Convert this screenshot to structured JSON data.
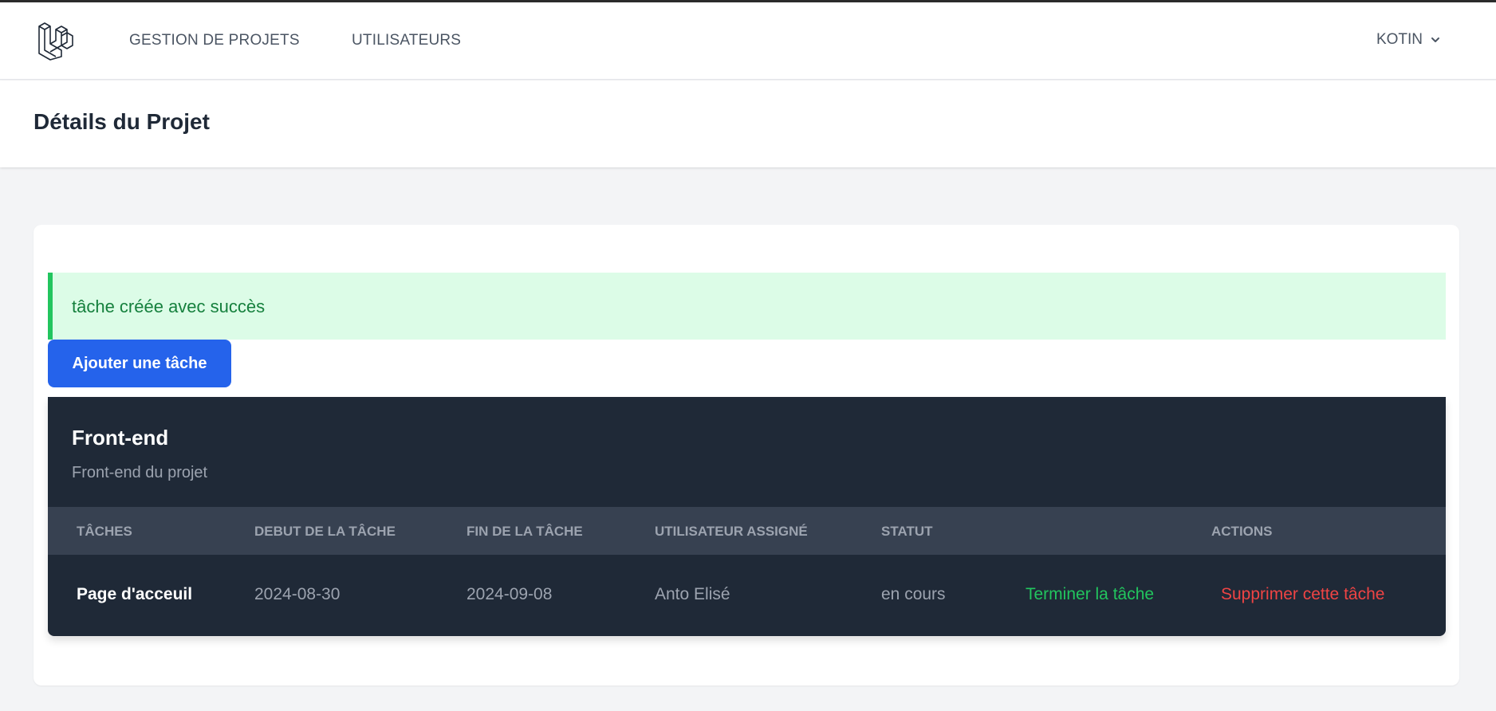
{
  "nav": {
    "links": [
      "GESTION DE PROJETS",
      "UTILISATEURS"
    ],
    "user_name": "KOTIN"
  },
  "header": {
    "title": "Détails du Projet"
  },
  "alert": {
    "message": "tâche créée avec succès"
  },
  "actions": {
    "add_task_label": "Ajouter une tâche"
  },
  "project": {
    "name": "Front-end",
    "description": "Front-end du projet",
    "columns": [
      "TÂCHES",
      "DEBUT DE LA TÂCHE",
      "FIN DE LA TÂCHE",
      "UTILISATEUR ASSIGNÉ",
      "STATUT",
      "ACTIONS"
    ],
    "tasks": [
      {
        "name": "Page d'acceuil",
        "start": "2024-08-30",
        "end": "2024-09-08",
        "assignee": "Anto Elisé",
        "status": "en cours",
        "finish_label": "Terminer la tâche",
        "delete_label": "Supprimer cette tâche"
      }
    ]
  },
  "colors": {
    "primary": "#2563eb",
    "success": "#22c55e",
    "danger": "#ef4444",
    "panel": "#1f2937",
    "table_header": "#374151"
  }
}
